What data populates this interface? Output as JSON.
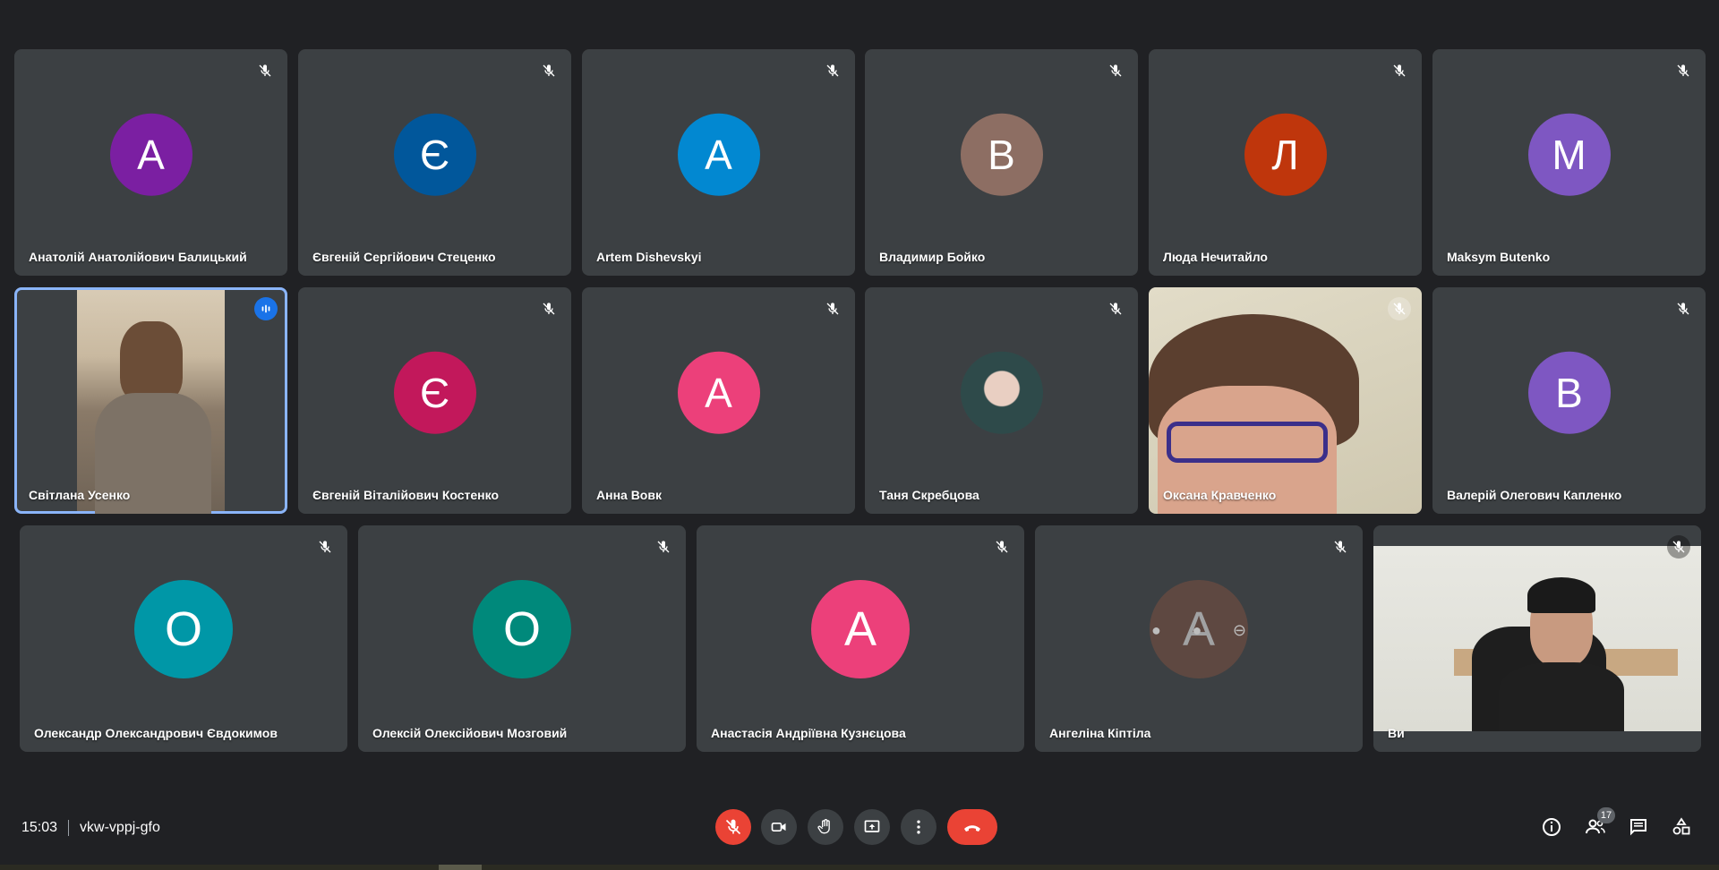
{
  "colors": {
    "tile_bg": "#3c4043",
    "page_bg": "#202124",
    "active_outline": "#8ab4f8",
    "end_call": "#ea4335"
  },
  "participants": [
    {
      "name": "Анатолій Анатолійович Балицький",
      "initial": "А",
      "avatar_color": "#7b1fa2",
      "muted": true
    },
    {
      "name": "Євгеній Сергійович Стеценко",
      "initial": "Є",
      "avatar_color": "#01579b",
      "muted": true
    },
    {
      "name": "Artem Dishevskyi",
      "initial": "A",
      "avatar_color": "#0288d1",
      "muted": true
    },
    {
      "name": "Владимир Бойко",
      "initial": "В",
      "avatar_color": "#8d6e63",
      "muted": true
    },
    {
      "name": "Люда Нечитайло",
      "initial": "Л",
      "avatar_color": "#bf360c",
      "muted": true
    },
    {
      "name": "Maksym Butenko",
      "initial": "M",
      "avatar_color": "#7e57c2",
      "muted": true
    },
    {
      "name": "Світлана Усенко",
      "video": true,
      "speaking": true
    },
    {
      "name": "Євгеній Віталійович Костенко",
      "initial": "Є",
      "avatar_color": "#c2185b",
      "muted": true
    },
    {
      "name": "Анна Вовк",
      "initial": "А",
      "avatar_color": "#ec407a",
      "muted": true
    },
    {
      "name": "Таня Скребцова",
      "photo": true,
      "muted": true
    },
    {
      "name": "Оксана Кравченко",
      "video": true,
      "muted": true
    },
    {
      "name": "Валерій Олегович Капленко",
      "initial": "В",
      "avatar_color": "#7e57c2",
      "muted": true
    },
    {
      "name": "Олександр Олександрович Євдокимов",
      "initial": "О",
      "avatar_color": "#0097a7",
      "muted": true
    },
    {
      "name": "Олексій Олексійович Мозговий",
      "initial": "О",
      "avatar_color": "#00897b",
      "muted": true
    },
    {
      "name": "Анастасія Андріївна Кузнєцова",
      "initial": "А",
      "avatar_color": "#ec407a",
      "muted": true
    },
    {
      "name": "Ангеліна Кіптіла",
      "initial": "А",
      "avatar_color": "#795548",
      "muted": true,
      "hover_controls": true
    },
    {
      "name": "Ви",
      "video": true,
      "muted": true
    }
  ],
  "bottom_bar": {
    "time": "15:03",
    "meeting_code": "vkw-vppj-gfo",
    "controls": [
      {
        "icon": "mic-off-icon",
        "label": "Microphone"
      },
      {
        "icon": "camera-icon",
        "label": "Camera"
      },
      {
        "icon": "raise-hand-icon",
        "label": "Raise hand"
      },
      {
        "icon": "present-icon",
        "label": "Present now"
      },
      {
        "icon": "more-options-icon",
        "label": "More options"
      },
      {
        "icon": "end-call-icon",
        "label": "Leave call"
      }
    ],
    "right_controls": [
      {
        "icon": "info-icon"
      },
      {
        "icon": "people-icon",
        "badge": "17"
      },
      {
        "icon": "chat-icon"
      },
      {
        "icon": "activities-icon"
      }
    ]
  }
}
